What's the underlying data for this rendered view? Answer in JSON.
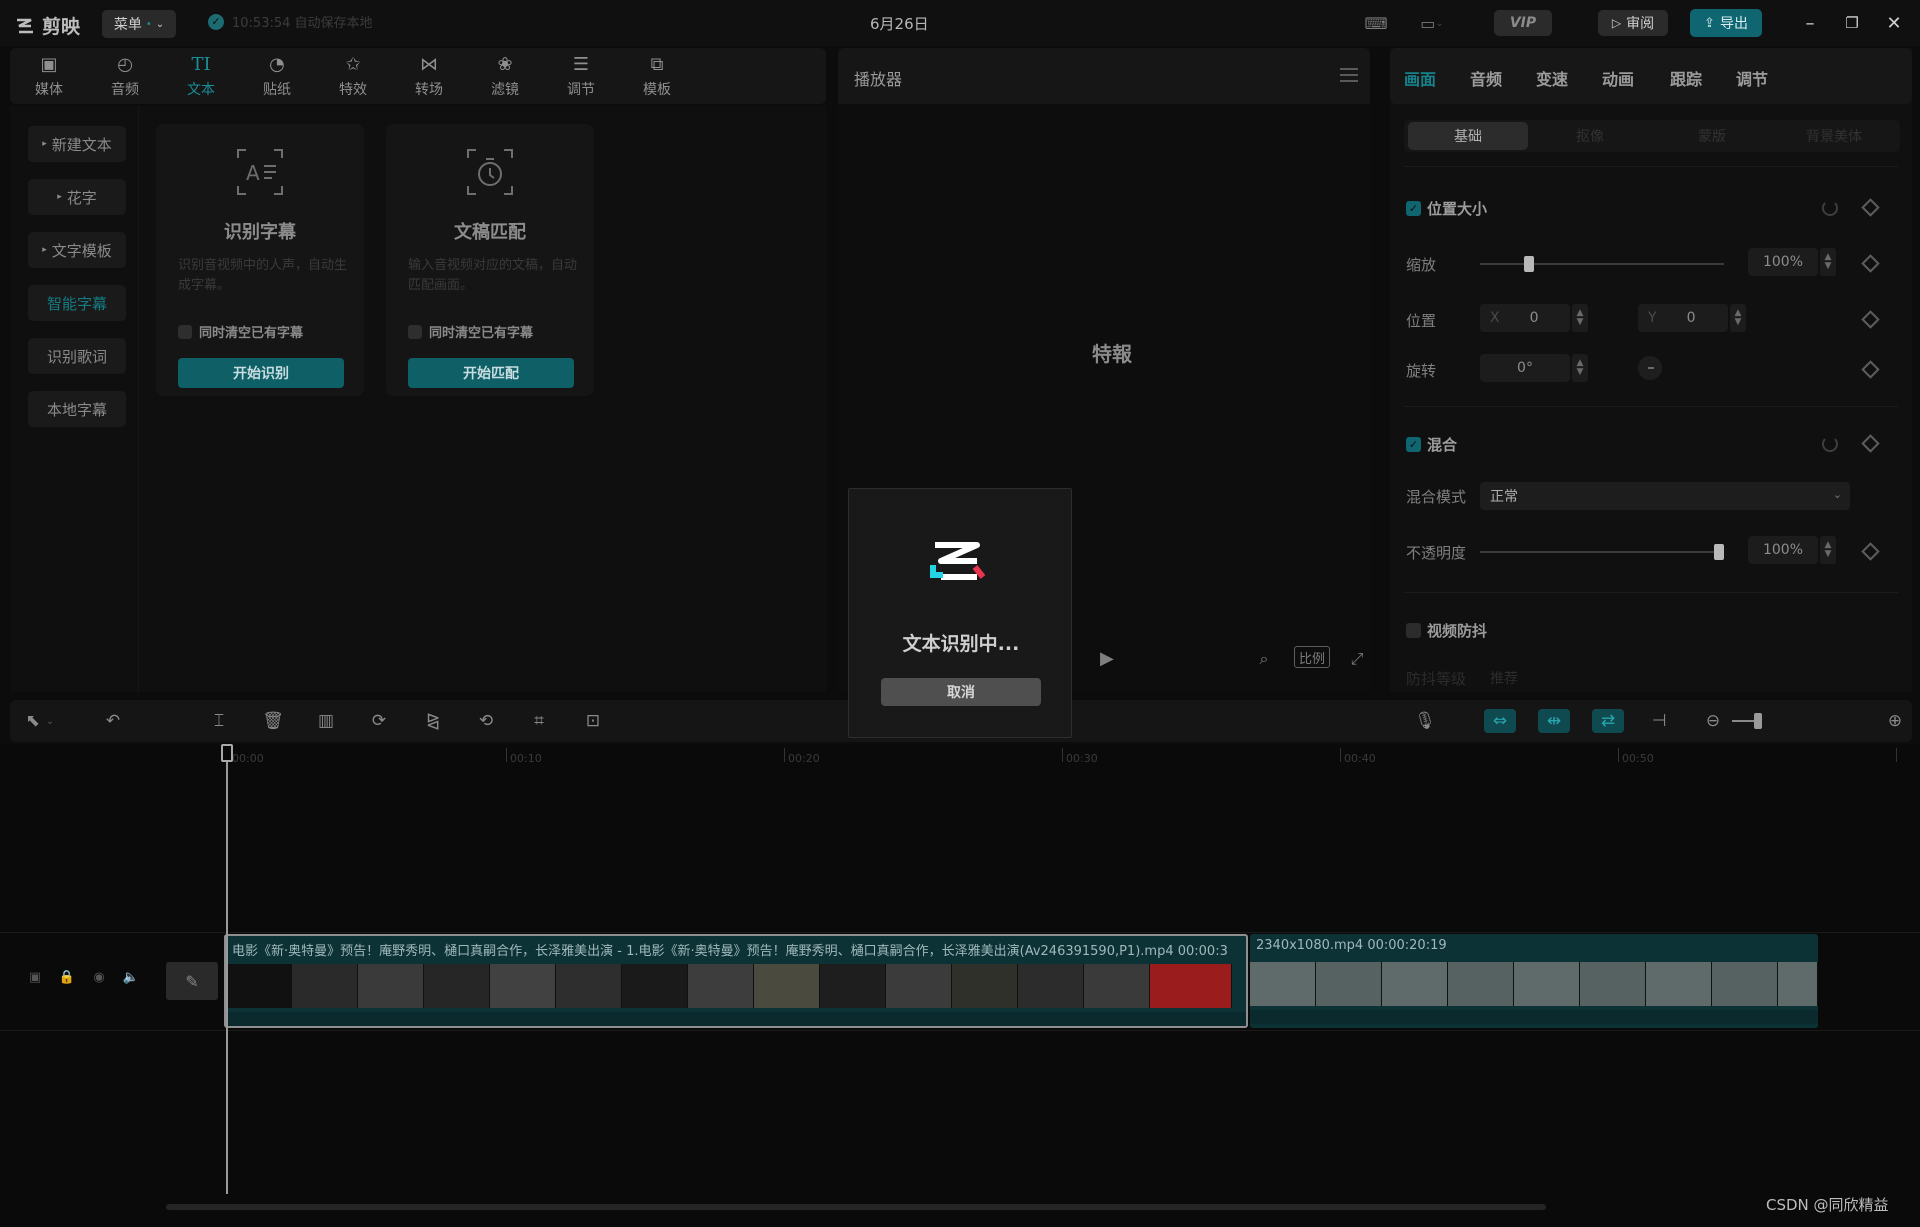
{
  "app": {
    "logo_text": "剪映",
    "menu_label": "菜单",
    "menu_dot": "•",
    "save_status": "10:53:54 自动保存本地",
    "date": "6月26日"
  },
  "titlebar": {
    "vip_label": "VIP",
    "review_label": "审阅",
    "export_label": "导出"
  },
  "tool_tabs": [
    {
      "label": "媒体",
      "icon": "media-icon"
    },
    {
      "label": "音频",
      "icon": "audio-icon"
    },
    {
      "label": "文本",
      "icon": "text-icon",
      "active": true
    },
    {
      "label": "贴纸",
      "icon": "sticker-icon"
    },
    {
      "label": "特效",
      "icon": "effects-icon"
    },
    {
      "label": "转场",
      "icon": "transition-icon"
    },
    {
      "label": "滤镜",
      "icon": "filter-icon"
    },
    {
      "label": "调节",
      "icon": "adjust-icon"
    },
    {
      "label": "模板",
      "icon": "template-icon"
    }
  ],
  "sidebar": [
    {
      "label": "新建文本",
      "arrow": "▸"
    },
    {
      "label": "花字",
      "arrow": "▸"
    },
    {
      "label": "文字模板",
      "arrow": "▸"
    },
    {
      "label": "智能字幕",
      "active": true
    },
    {
      "label": "识别歌词"
    },
    {
      "label": "本地字幕"
    }
  ],
  "cards": [
    {
      "title": "识别字幕",
      "desc": "识别音视频中的人声，自动生成字幕。",
      "option": "同时清空已有字幕",
      "button": "开始识别"
    },
    {
      "title": "文稿匹配",
      "desc": "输入音视频对应的文稿，自动匹配画面。",
      "option": "同时清空已有字幕",
      "button": "开始匹配"
    }
  ],
  "player": {
    "title": "播放器",
    "overlay_text": "特報",
    "ratio_label": "比例"
  },
  "right_tabs": [
    {
      "label": "画面",
      "active": true
    },
    {
      "label": "音频"
    },
    {
      "label": "变速"
    },
    {
      "label": "动画"
    },
    {
      "label": "跟踪"
    },
    {
      "label": "调节"
    }
  ],
  "segments": [
    "基础",
    "抠像",
    "蒙版",
    "背景美体"
  ],
  "props": {
    "pos_size_label": "位置大小",
    "scale_label": "缩放",
    "scale_value": "100%",
    "scale_level": 0.2,
    "position_label": "位置",
    "x_label": "X",
    "x_value": "0",
    "y_label": "Y",
    "y_value": "0",
    "rotate_label": "旋转",
    "rotate_value": "0°",
    "blend_label": "混合",
    "blend_mode_label": "混合模式",
    "blend_mode_value": "正常",
    "opacity_label": "不透明度",
    "opacity_value": "100%",
    "opacity_level": 1.0,
    "stabilize_label": "视频防抖",
    "stabilize_level_label": "防抖等级",
    "stabilize_level_value": "推荐"
  },
  "ruler": [
    "00:00",
    "00:10",
    "00:20",
    "00:30",
    "00:40",
    "00:50"
  ],
  "clips": [
    {
      "label": "电影《新·奥特曼》预告！庵野秀明、樋口真嗣合作，长泽雅美出演 - 1.电影《新·奥特曼》预告！庵野秀明、樋口真嗣合作，长泽雅美出演(Av246391590,P1).mp4   00:00:3"
    },
    {
      "label": "2340x1080.mp4   00:00:20:19"
    }
  ],
  "dialog": {
    "text": "文本识别中...",
    "cancel": "取消"
  },
  "watermark": "CSDN @同欣精益",
  "colors": {
    "accent": "#0f6670",
    "accent_text": "#16838c",
    "background": "#0c0c0c"
  }
}
